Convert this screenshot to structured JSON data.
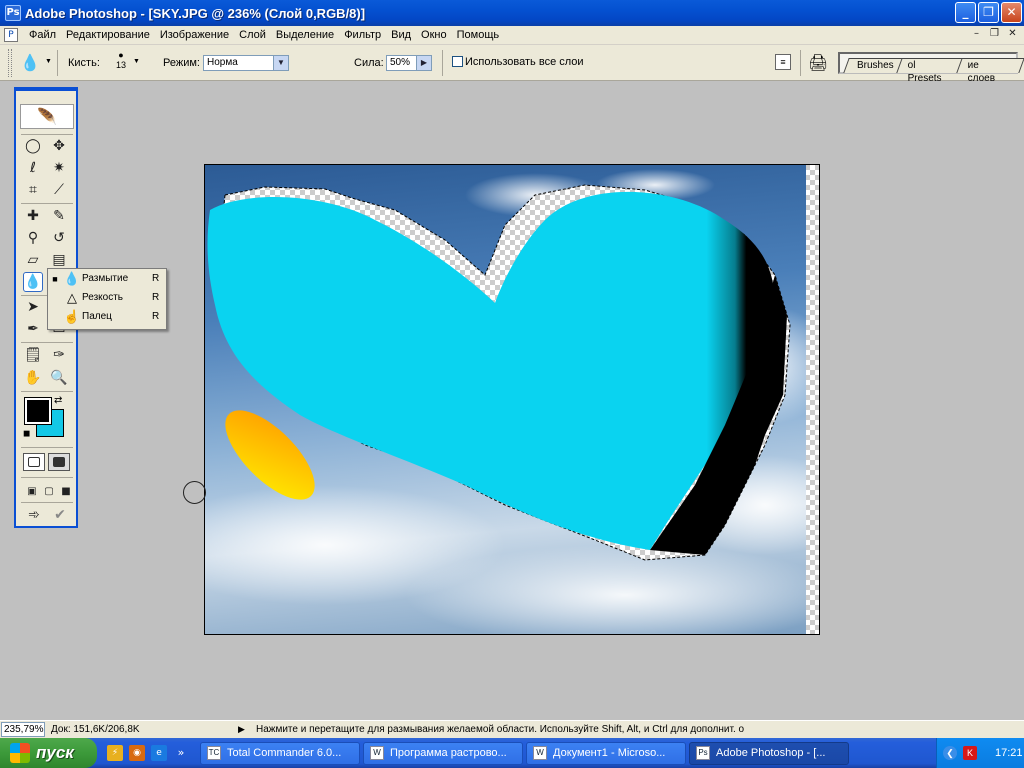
{
  "window": {
    "title": "Adobe Photoshop - [SKY.JPG @ 236% (Слой 0,RGB/8)]",
    "app_icon": "photoshop-feather-icon"
  },
  "menu": [
    "Файл",
    "Редактирование",
    "Изображение",
    "Слой",
    "Выделение",
    "Фильтр",
    "Вид",
    "Окно",
    "Помощь"
  ],
  "options": {
    "tool_icon": "blur-drop-icon",
    "brush_label": "Кисть:",
    "brush_size": "13",
    "mode_label": "Режим:",
    "mode_value": "Норма",
    "strength_label": "Сила:",
    "strength_value": "50%",
    "all_layers_label": "Использовать все слои",
    "all_layers_checked": false,
    "palette_tabs": [
      "Brushes",
      "ol Presets",
      "ие слоев"
    ]
  },
  "toolbox": {
    "active_tool": "blur",
    "foreground_color": "#000000",
    "background_color": "#13c8e6"
  },
  "flyout": {
    "items": [
      {
        "label": "Размытие",
        "key": "R",
        "icon": "blur-drop-icon",
        "selected": true
      },
      {
        "label": "Резкость",
        "key": "R",
        "icon": "sharpen-cone-icon",
        "selected": false
      },
      {
        "label": "Палец",
        "key": "R",
        "icon": "smudge-finger-icon",
        "selected": false
      }
    ]
  },
  "canvas": {
    "document": "SKY.JPG",
    "heart_color": "#0ad3f0",
    "brush_stroke_colors": [
      "#ff9a00",
      "#ffe800"
    ]
  },
  "status": {
    "zoom": "235,79%",
    "doc": "Док: 151,6K/206,8K",
    "hint": "Нажмите и перетащите для размывания желаемой области. Используйте Shift, Alt, и Ctrl для дополнит. о"
  },
  "taskbar": {
    "start_label": "пуск",
    "tasks": [
      {
        "label": "Total Commander 6.0...",
        "active": false
      },
      {
        "label": "Программа растрово...",
        "active": false
      },
      {
        "label": "Документ1 - Microso...",
        "active": false
      },
      {
        "label": "Adobe Photoshop - [...",
        "active": true
      }
    ],
    "clock": "17:21"
  }
}
